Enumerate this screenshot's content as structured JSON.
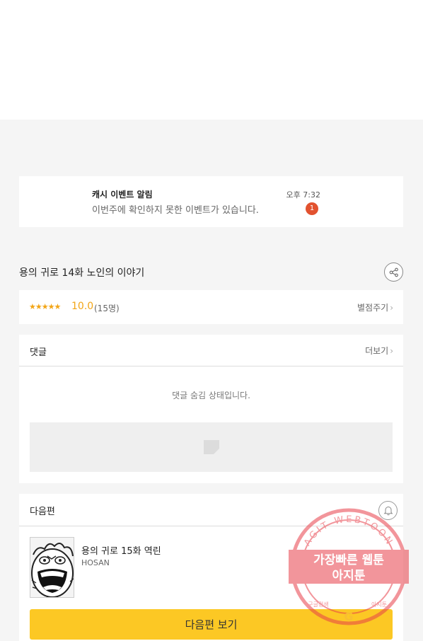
{
  "notification": {
    "title": "캐시 이벤트 알림",
    "message": "이번주에 확인하지 못한 이벤트가 있습니다.",
    "time": "오후 7:32",
    "badge_count": "1"
  },
  "episode": {
    "title": "용의 귀로 14화 노인의 이야기",
    "share_icon": "share-icon"
  },
  "rating": {
    "stars": "★★★★★",
    "score": "10.0",
    "count": "(15명)",
    "rate_label": "별점주기"
  },
  "comments": {
    "label": "댓글",
    "more_label": "더보기",
    "hidden_message": "댓글 숨김 상태입니다."
  },
  "next_episode": {
    "label": "다음편",
    "title": "용의 귀로 15화 역린",
    "author": "HOSAN",
    "button_label": "다음편 보기",
    "bell_icon": "bell-icon"
  },
  "watermark": {
    "arc_text": "AGIT WEBTOON",
    "line1": "가장빠른 웹툰",
    "line2": "아지툰",
    "bottom_left": "구글검색",
    "bottom_right": "아지툰",
    "center_glyph": "G"
  },
  "colors": {
    "accent_yellow": "#fcc824",
    "star_orange": "#f2a516",
    "badge_red": "#e2522f",
    "watermark_red": "#e8404a"
  },
  "chevron": "›"
}
